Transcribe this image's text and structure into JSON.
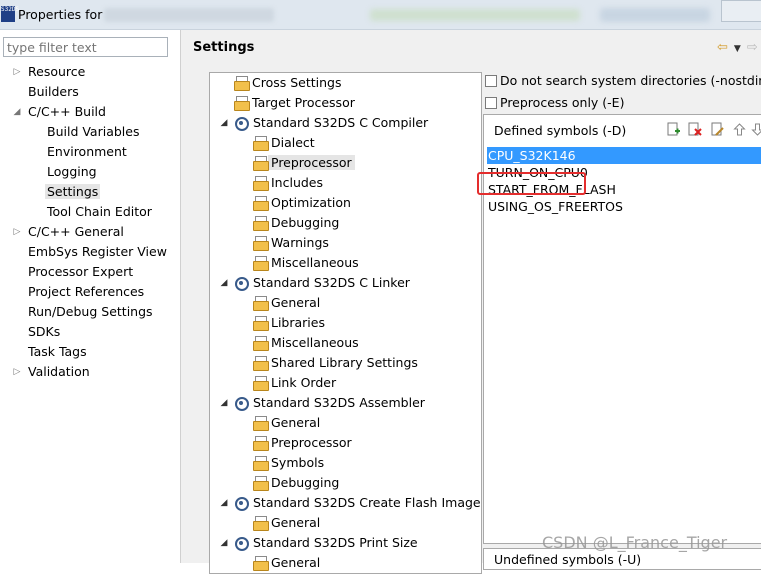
{
  "window": {
    "title": "Properties for",
    "app_icon_text": "S32DS"
  },
  "filter": {
    "placeholder": "type filter text"
  },
  "nav": [
    {
      "label": "Resource",
      "arrow": "▷"
    },
    {
      "label": "Builders",
      "arrow": ""
    },
    {
      "label": "C/C++ Build",
      "arrow": "◢"
    },
    {
      "label": "Build Variables",
      "arrow": ""
    },
    {
      "label": "Environment",
      "arrow": ""
    },
    {
      "label": "Logging",
      "arrow": ""
    },
    {
      "label": "Settings",
      "arrow": "",
      "selected": true
    },
    {
      "label": "Tool Chain Editor",
      "arrow": ""
    },
    {
      "label": "C/C++ General",
      "arrow": "▷"
    },
    {
      "label": "EmbSys Register View",
      "arrow": ""
    },
    {
      "label": "Processor Expert",
      "arrow": ""
    },
    {
      "label": "Project References",
      "arrow": ""
    },
    {
      "label": "Run/Debug Settings",
      "arrow": ""
    },
    {
      "label": "SDKs",
      "arrow": ""
    },
    {
      "label": "Task Tags",
      "arrow": ""
    },
    {
      "label": "Validation",
      "arrow": "▷"
    }
  ],
  "settings": {
    "title": "Settings"
  },
  "tool_tree": [
    {
      "label": "Cross Settings"
    },
    {
      "label": "Target Processor"
    },
    {
      "label": "Standard S32DS C Compiler",
      "arrow": "◢"
    },
    {
      "label": "Dialect"
    },
    {
      "label": "Preprocessor",
      "selected": true
    },
    {
      "label": "Includes"
    },
    {
      "label": "Optimization"
    },
    {
      "label": "Debugging"
    },
    {
      "label": "Warnings"
    },
    {
      "label": "Miscellaneous"
    },
    {
      "label": "Standard S32DS C Linker",
      "arrow": "◢"
    },
    {
      "label": "General"
    },
    {
      "label": "Libraries"
    },
    {
      "label": "Miscellaneous"
    },
    {
      "label": "Shared Library Settings"
    },
    {
      "label": "Link Order"
    },
    {
      "label": "Standard S32DS Assembler",
      "arrow": "◢"
    },
    {
      "label": "General"
    },
    {
      "label": "Preprocessor"
    },
    {
      "label": "Symbols"
    },
    {
      "label": "Debugging"
    },
    {
      "label": "Standard S32DS Create Flash Image",
      "arrow": "◢"
    },
    {
      "label": "General"
    },
    {
      "label": "Standard S32DS Print Size",
      "arrow": "◢"
    },
    {
      "label": "General"
    }
  ],
  "options": {
    "nostdinc_label": "Do not search system directories (-nostdinc)",
    "preprocess_label": "Preprocess only (-E)"
  },
  "defined_symbols": {
    "header": "Defined symbols (-D)",
    "items": [
      "CPU_S32K146",
      "TURN_ON_CPU0",
      "START_FROM_FLASH",
      "USING_OS_FREERTOS"
    ]
  },
  "undefined_symbols": {
    "header": "Undefined symbols (-U)"
  },
  "watermark": "CSDN @L_France_Tiger",
  "colors": {
    "selection": "#3399ff",
    "highlight_box": "#e42d2d"
  }
}
